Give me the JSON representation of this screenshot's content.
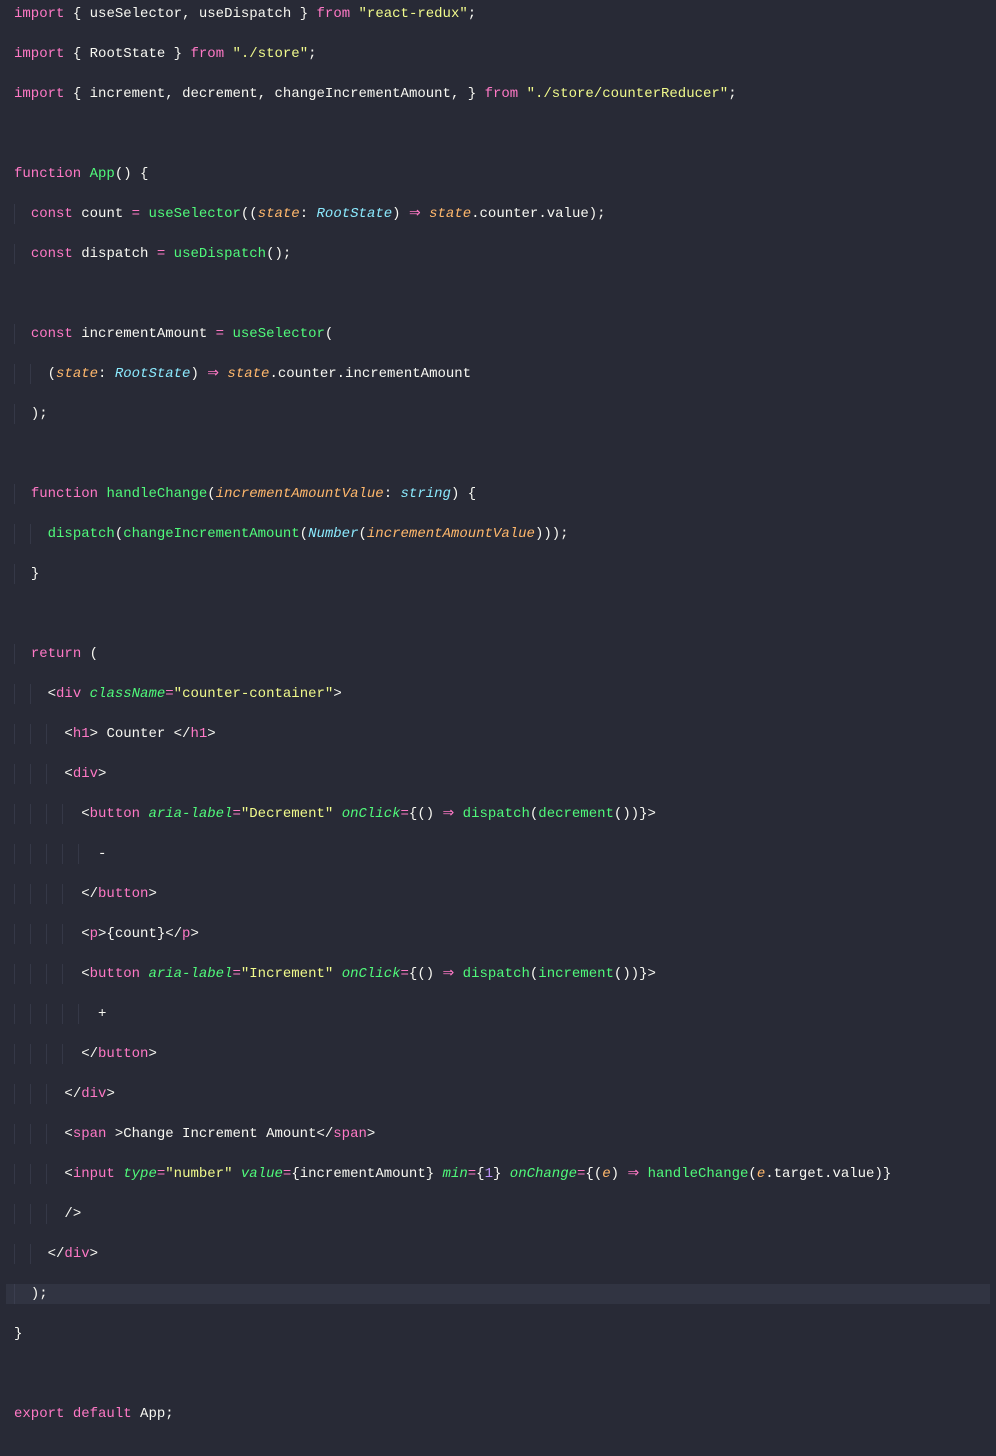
{
  "language": "tsx",
  "code": {
    "lines": [
      {
        "indent": 0,
        "hl": false,
        "tokens": [
          {
            "c": "kw",
            "t": "import"
          },
          {
            "c": "pun",
            "t": " { "
          },
          {
            "c": "id",
            "t": "useSelector"
          },
          {
            "c": "pun",
            "t": ", "
          },
          {
            "c": "id",
            "t": "useDispatch"
          },
          {
            "c": "pun",
            "t": " } "
          },
          {
            "c": "kw",
            "t": "from"
          },
          {
            "c": "pun",
            "t": " "
          },
          {
            "c": "str",
            "t": "\"react-redux\""
          },
          {
            "c": "pun",
            "t": ";"
          }
        ]
      },
      {
        "indent": 0,
        "hl": false,
        "tokens": [
          {
            "c": "kw",
            "t": "import"
          },
          {
            "c": "pun",
            "t": " { "
          },
          {
            "c": "id",
            "t": "RootState"
          },
          {
            "c": "pun",
            "t": " } "
          },
          {
            "c": "kw",
            "t": "from"
          },
          {
            "c": "pun",
            "t": " "
          },
          {
            "c": "str",
            "t": "\"./store\""
          },
          {
            "c": "pun",
            "t": ";"
          }
        ]
      },
      {
        "indent": 0,
        "hl": false,
        "tokens": [
          {
            "c": "kw",
            "t": "import"
          },
          {
            "c": "pun",
            "t": " { "
          },
          {
            "c": "id",
            "t": "increment"
          },
          {
            "c": "pun",
            "t": ", "
          },
          {
            "c": "id",
            "t": "decrement"
          },
          {
            "c": "pun",
            "t": ", "
          },
          {
            "c": "id",
            "t": "changeIncrementAmount"
          },
          {
            "c": "pun",
            "t": ", } "
          },
          {
            "c": "kw",
            "t": "from"
          },
          {
            "c": "pun",
            "t": " "
          },
          {
            "c": "str",
            "t": "\"./store/counterReducer\""
          },
          {
            "c": "pun",
            "t": ";"
          }
        ]
      },
      {
        "indent": 0,
        "hl": false,
        "tokens": []
      },
      {
        "indent": 0,
        "hl": false,
        "tokens": [
          {
            "c": "kw",
            "t": "function"
          },
          {
            "c": "pun",
            "t": " "
          },
          {
            "c": "fn",
            "t": "App"
          },
          {
            "c": "pun",
            "t": "() {"
          }
        ]
      },
      {
        "indent": 1,
        "hl": false,
        "tokens": [
          {
            "c": "kw",
            "t": "const"
          },
          {
            "c": "pun",
            "t": " "
          },
          {
            "c": "id",
            "t": "count"
          },
          {
            "c": "pun",
            "t": " "
          },
          {
            "c": "kw",
            "t": "="
          },
          {
            "c": "pun",
            "t": " "
          },
          {
            "c": "fn",
            "t": "useSelector"
          },
          {
            "c": "pun",
            "t": "(("
          },
          {
            "c": "param",
            "t": "state"
          },
          {
            "c": "pun",
            "t": ": "
          },
          {
            "c": "type",
            "t": "RootState"
          },
          {
            "c": "pun",
            "t": ") "
          },
          {
            "c": "arrow",
            "t": "⇒"
          },
          {
            "c": "pun",
            "t": " "
          },
          {
            "c": "param",
            "t": "state"
          },
          {
            "c": "pun",
            "t": ".counter.value);"
          }
        ]
      },
      {
        "indent": 1,
        "hl": false,
        "tokens": [
          {
            "c": "kw",
            "t": "const"
          },
          {
            "c": "pun",
            "t": " "
          },
          {
            "c": "id",
            "t": "dispatch"
          },
          {
            "c": "pun",
            "t": " "
          },
          {
            "c": "kw",
            "t": "="
          },
          {
            "c": "pun",
            "t": " "
          },
          {
            "c": "fn",
            "t": "useDispatch"
          },
          {
            "c": "pun",
            "t": "();"
          }
        ]
      },
      {
        "indent": 0,
        "hl": false,
        "tokens": []
      },
      {
        "indent": 1,
        "hl": false,
        "tokens": [
          {
            "c": "kw",
            "t": "const"
          },
          {
            "c": "pun",
            "t": " "
          },
          {
            "c": "id",
            "t": "incrementAmount"
          },
          {
            "c": "pun",
            "t": " "
          },
          {
            "c": "kw",
            "t": "="
          },
          {
            "c": "pun",
            "t": " "
          },
          {
            "c": "fn",
            "t": "useSelector"
          },
          {
            "c": "pun",
            "t": "("
          }
        ]
      },
      {
        "indent": 2,
        "hl": false,
        "tokens": [
          {
            "c": "pun",
            "t": "("
          },
          {
            "c": "param",
            "t": "state"
          },
          {
            "c": "pun",
            "t": ": "
          },
          {
            "c": "type",
            "t": "RootState"
          },
          {
            "c": "pun",
            "t": ") "
          },
          {
            "c": "arrow",
            "t": "⇒"
          },
          {
            "c": "pun",
            "t": " "
          },
          {
            "c": "param",
            "t": "state"
          },
          {
            "c": "pun",
            "t": ".counter.incrementAmount"
          }
        ]
      },
      {
        "indent": 1,
        "hl": false,
        "tokens": [
          {
            "c": "pun",
            "t": ");"
          }
        ]
      },
      {
        "indent": 0,
        "hl": false,
        "tokens": []
      },
      {
        "indent": 1,
        "hl": false,
        "tokens": [
          {
            "c": "kw",
            "t": "function"
          },
          {
            "c": "pun",
            "t": " "
          },
          {
            "c": "fn",
            "t": "handleChange"
          },
          {
            "c": "pun",
            "t": "("
          },
          {
            "c": "param",
            "t": "incrementAmountValue"
          },
          {
            "c": "pun",
            "t": ": "
          },
          {
            "c": "type",
            "t": "string"
          },
          {
            "c": "pun",
            "t": ") {"
          }
        ]
      },
      {
        "indent": 2,
        "hl": false,
        "tokens": [
          {
            "c": "fn",
            "t": "dispatch"
          },
          {
            "c": "pun",
            "t": "("
          },
          {
            "c": "fn",
            "t": "changeIncrementAmount"
          },
          {
            "c": "pun",
            "t": "("
          },
          {
            "c": "type",
            "t": "Number"
          },
          {
            "c": "pun",
            "t": "("
          },
          {
            "c": "param",
            "t": "incrementAmountValue"
          },
          {
            "c": "pun",
            "t": ")));"
          }
        ]
      },
      {
        "indent": 1,
        "hl": false,
        "tokens": [
          {
            "c": "pun",
            "t": "}"
          }
        ]
      },
      {
        "indent": 0,
        "hl": false,
        "tokens": []
      },
      {
        "indent": 1,
        "hl": false,
        "tokens": [
          {
            "c": "kw",
            "t": "return"
          },
          {
            "c": "pun",
            "t": " ("
          }
        ]
      },
      {
        "indent": 2,
        "hl": false,
        "tokens": [
          {
            "c": "pun",
            "t": "<"
          },
          {
            "c": "tag",
            "t": "div"
          },
          {
            "c": "pun",
            "t": " "
          },
          {
            "c": "attr",
            "t": "className"
          },
          {
            "c": "kw",
            "t": "="
          },
          {
            "c": "str",
            "t": "\"counter-container\""
          },
          {
            "c": "pun",
            "t": ">"
          }
        ]
      },
      {
        "indent": 3,
        "hl": false,
        "tokens": [
          {
            "c": "pun",
            "t": "<"
          },
          {
            "c": "tag",
            "t": "h1"
          },
          {
            "c": "pun",
            "t": "> Counter </"
          },
          {
            "c": "tag",
            "t": "h1"
          },
          {
            "c": "pun",
            "t": ">"
          }
        ]
      },
      {
        "indent": 3,
        "hl": false,
        "tokens": [
          {
            "c": "pun",
            "t": "<"
          },
          {
            "c": "tag",
            "t": "div"
          },
          {
            "c": "pun",
            "t": ">"
          }
        ]
      },
      {
        "indent": 4,
        "hl": false,
        "tokens": [
          {
            "c": "pun",
            "t": "<"
          },
          {
            "c": "tag",
            "t": "button"
          },
          {
            "c": "pun",
            "t": " "
          },
          {
            "c": "attr",
            "t": "aria-label"
          },
          {
            "c": "kw",
            "t": "="
          },
          {
            "c": "str",
            "t": "\"Decrement\""
          },
          {
            "c": "pun",
            "t": " "
          },
          {
            "c": "attr",
            "t": "onClick"
          },
          {
            "c": "kw",
            "t": "="
          },
          {
            "c": "pun",
            "t": "{() "
          },
          {
            "c": "arrow",
            "t": "⇒"
          },
          {
            "c": "pun",
            "t": " "
          },
          {
            "c": "fn",
            "t": "dispatch"
          },
          {
            "c": "pun",
            "t": "("
          },
          {
            "c": "fn",
            "t": "decrement"
          },
          {
            "c": "pun",
            "t": "())}>"
          }
        ]
      },
      {
        "indent": 5,
        "hl": false,
        "tokens": [
          {
            "c": "pun",
            "t": "-"
          }
        ]
      },
      {
        "indent": 4,
        "hl": false,
        "tokens": [
          {
            "c": "pun",
            "t": "</"
          },
          {
            "c": "tag",
            "t": "button"
          },
          {
            "c": "pun",
            "t": ">"
          }
        ]
      },
      {
        "indent": 4,
        "hl": false,
        "tokens": [
          {
            "c": "pun",
            "t": "<"
          },
          {
            "c": "tag",
            "t": "p"
          },
          {
            "c": "pun",
            "t": ">{count}</"
          },
          {
            "c": "tag",
            "t": "p"
          },
          {
            "c": "pun",
            "t": ">"
          }
        ]
      },
      {
        "indent": 4,
        "hl": false,
        "tokens": [
          {
            "c": "pun",
            "t": "<"
          },
          {
            "c": "tag",
            "t": "button"
          },
          {
            "c": "pun",
            "t": " "
          },
          {
            "c": "attr",
            "t": "aria-label"
          },
          {
            "c": "kw",
            "t": "="
          },
          {
            "c": "str",
            "t": "\"Increment\""
          },
          {
            "c": "pun",
            "t": " "
          },
          {
            "c": "attr",
            "t": "onClick"
          },
          {
            "c": "kw",
            "t": "="
          },
          {
            "c": "pun",
            "t": "{() "
          },
          {
            "c": "arrow",
            "t": "⇒"
          },
          {
            "c": "pun",
            "t": " "
          },
          {
            "c": "fn",
            "t": "dispatch"
          },
          {
            "c": "pun",
            "t": "("
          },
          {
            "c": "fn",
            "t": "increment"
          },
          {
            "c": "pun",
            "t": "())}>"
          }
        ]
      },
      {
        "indent": 5,
        "hl": false,
        "tokens": [
          {
            "c": "pun",
            "t": "+"
          }
        ]
      },
      {
        "indent": 4,
        "hl": false,
        "tokens": [
          {
            "c": "pun",
            "t": "</"
          },
          {
            "c": "tag",
            "t": "button"
          },
          {
            "c": "pun",
            "t": ">"
          }
        ]
      },
      {
        "indent": 3,
        "hl": false,
        "tokens": [
          {
            "c": "pun",
            "t": "</"
          },
          {
            "c": "tag",
            "t": "div"
          },
          {
            "c": "pun",
            "t": ">"
          }
        ]
      },
      {
        "indent": 3,
        "hl": false,
        "tokens": [
          {
            "c": "pun",
            "t": "<"
          },
          {
            "c": "tag",
            "t": "span"
          },
          {
            "c": "pun",
            "t": " >Change Increment Amount</"
          },
          {
            "c": "tag",
            "t": "span"
          },
          {
            "c": "pun",
            "t": ">"
          }
        ]
      },
      {
        "indent": 3,
        "hl": false,
        "tokens": [
          {
            "c": "pun",
            "t": "<"
          },
          {
            "c": "tag",
            "t": "input"
          },
          {
            "c": "pun",
            "t": " "
          },
          {
            "c": "attr",
            "t": "type"
          },
          {
            "c": "kw",
            "t": "="
          },
          {
            "c": "str",
            "t": "\"number\""
          },
          {
            "c": "pun",
            "t": " "
          },
          {
            "c": "attr",
            "t": "value"
          },
          {
            "c": "kw",
            "t": "="
          },
          {
            "c": "pun",
            "t": "{incrementAmount} "
          },
          {
            "c": "attr",
            "t": "min"
          },
          {
            "c": "kw",
            "t": "="
          },
          {
            "c": "pun",
            "t": "{"
          },
          {
            "c": "num",
            "t": "1"
          },
          {
            "c": "pun",
            "t": "} "
          },
          {
            "c": "attr",
            "t": "onChange"
          },
          {
            "c": "kw",
            "t": "="
          },
          {
            "c": "pun",
            "t": "{("
          },
          {
            "c": "param",
            "t": "e"
          },
          {
            "c": "pun",
            "t": ") "
          },
          {
            "c": "arrow",
            "t": "⇒"
          },
          {
            "c": "pun",
            "t": " "
          },
          {
            "c": "fn",
            "t": "handleChange"
          },
          {
            "c": "pun",
            "t": "("
          },
          {
            "c": "param",
            "t": "e"
          },
          {
            "c": "pun",
            "t": ".target.value)}"
          }
        ]
      },
      {
        "indent": 3,
        "hl": false,
        "tokens": [
          {
            "c": "pun",
            "t": "/>"
          }
        ]
      },
      {
        "indent": 2,
        "hl": false,
        "tokens": [
          {
            "c": "pun",
            "t": "</"
          },
          {
            "c": "tag",
            "t": "div"
          },
          {
            "c": "pun",
            "t": ">"
          }
        ]
      },
      {
        "indent": 1,
        "hl": true,
        "tokens": [
          {
            "c": "pun",
            "t": ");"
          }
        ]
      },
      {
        "indent": 0,
        "hl": false,
        "tokens": [
          {
            "c": "pun",
            "t": "}"
          }
        ]
      },
      {
        "indent": 0,
        "hl": false,
        "tokens": []
      },
      {
        "indent": 0,
        "hl": false,
        "tokens": [
          {
            "c": "kw",
            "t": "export"
          },
          {
            "c": "pun",
            "t": " "
          },
          {
            "c": "kw",
            "t": "default"
          },
          {
            "c": "pun",
            "t": " "
          },
          {
            "c": "id",
            "t": "App"
          },
          {
            "c": "pun",
            "t": ";"
          }
        ]
      }
    ]
  },
  "indent_width": 2,
  "indent_pixel": 16
}
